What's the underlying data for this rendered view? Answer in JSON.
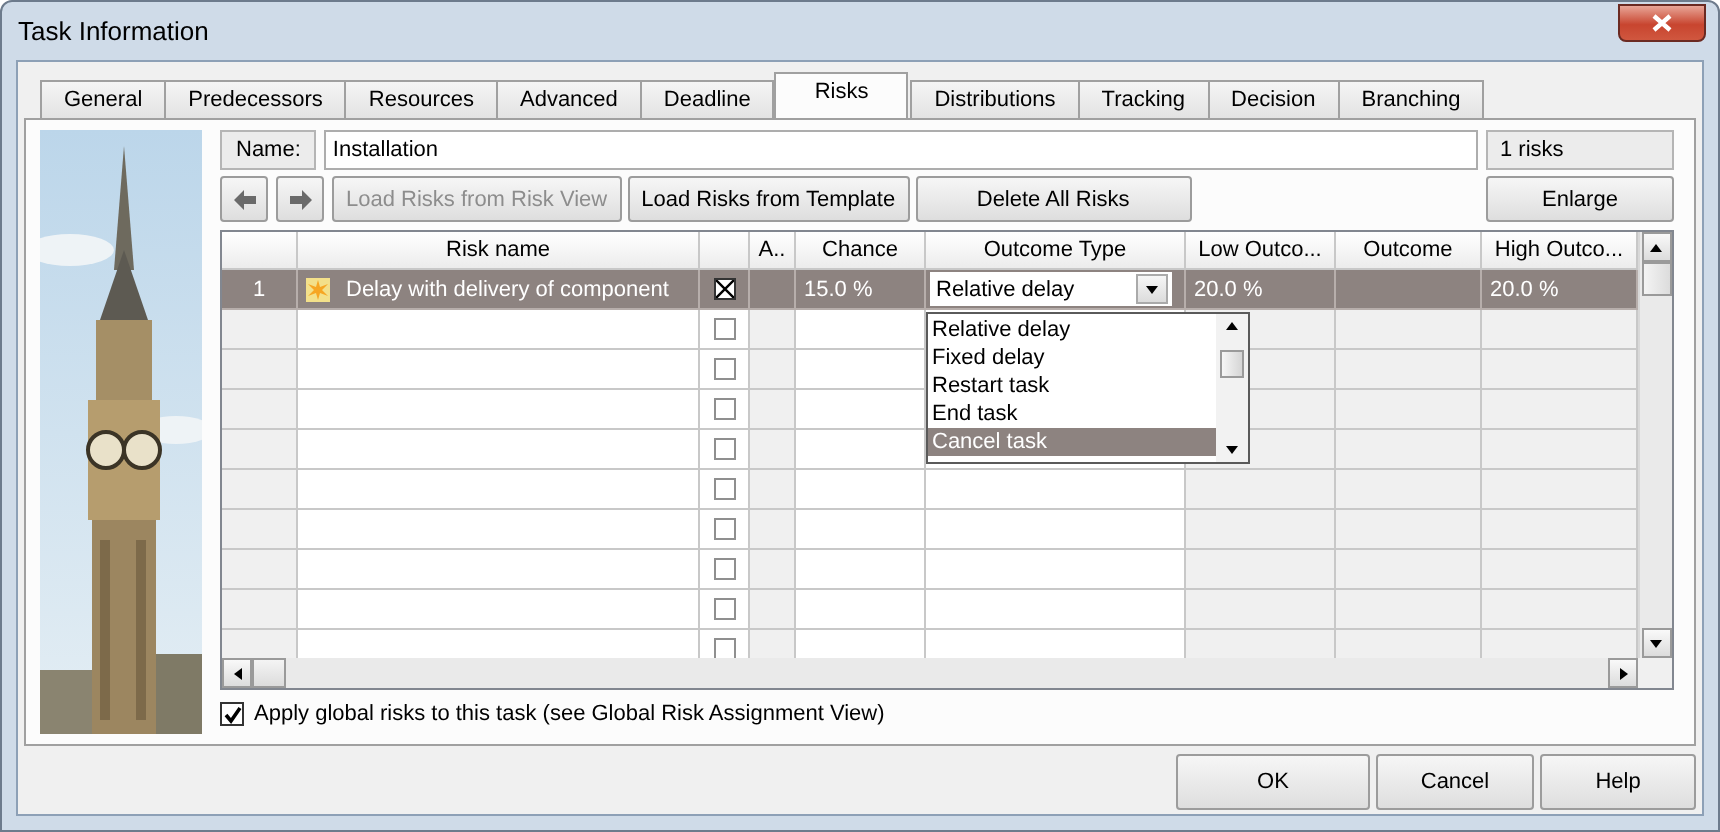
{
  "window": {
    "title": "Task Information"
  },
  "tabs": [
    {
      "label": "General",
      "selected": false
    },
    {
      "label": "Predecessors",
      "selected": false
    },
    {
      "label": "Resources",
      "selected": false
    },
    {
      "label": "Advanced",
      "selected": false
    },
    {
      "label": "Deadline",
      "selected": false
    },
    {
      "label": "Risks",
      "selected": true
    },
    {
      "label": "Distributions",
      "selected": false
    },
    {
      "label": "Tracking",
      "selected": false
    },
    {
      "label": "Decision",
      "selected": false
    },
    {
      "label": "Branching",
      "selected": false
    }
  ],
  "name_field": {
    "label": "Name:",
    "value": "Installation"
  },
  "risk_count": "1 risks",
  "toolbar": [
    {
      "label": "Load Risks from Risk View",
      "disabled": true
    },
    {
      "label": "Load Risks from Template",
      "disabled": false
    },
    {
      "label": "Delete All Risks",
      "disabled": false
    }
  ],
  "enlarge_button": "Enlarge",
  "table": {
    "columns": [
      "Risk name",
      "A..",
      "Chance",
      "Outcome Type",
      "Low Outco...",
      "Outcome",
      "High Outco..."
    ],
    "rows": [
      {
        "number": "1",
        "selected": true,
        "risk_name": "Delay with delivery of component",
        "checked": true,
        "chance": "15.0 %",
        "outcome_type": "Relative delay",
        "low_outcome": "20.0 %",
        "high_outcome": "20.0 %"
      },
      {
        "selected": false,
        "checked": false
      },
      {
        "selected": false,
        "checked": false
      },
      {
        "selected": false,
        "checked": false
      },
      {
        "selected": false,
        "checked": false
      },
      {
        "selected": false,
        "checked": false
      },
      {
        "selected": false,
        "checked": false
      },
      {
        "selected": false,
        "checked": false
      },
      {
        "selected": false,
        "checked": false
      },
      {
        "selected": false,
        "checked": false
      }
    ]
  },
  "dropdown": {
    "options": [
      {
        "label": "Relative delay",
        "selected": false
      },
      {
        "label": "Fixed delay",
        "selected": false
      },
      {
        "label": "Restart task",
        "selected": false
      },
      {
        "label": "End task",
        "selected": false
      },
      {
        "label": "Cancel task",
        "selected": true
      }
    ]
  },
  "global_risks": {
    "label": "Apply global risks to this task (see Global Risk Assignment View)",
    "checked": true
  },
  "dialog_buttons": [
    "OK",
    "Cancel",
    "Help"
  ]
}
